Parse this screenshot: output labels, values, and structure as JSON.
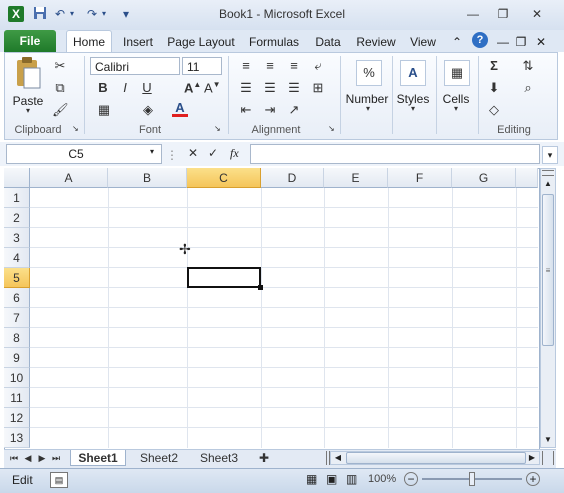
{
  "window": {
    "title": "Book1  -  Microsoft Excel",
    "qat_icons": [
      "excel-logo-icon",
      "save-icon",
      "undo-icon",
      "redo-icon",
      "customize-qat-icon"
    ],
    "controls": [
      "minimize",
      "restore",
      "close"
    ]
  },
  "tabs": {
    "file": "File",
    "items": [
      "Home",
      "Insert",
      "Page Layout",
      "Formulas",
      "Data",
      "Review",
      "View"
    ],
    "active": "Home"
  },
  "ribbon": {
    "clipboard": {
      "paste_label": "Paste",
      "group_label": "Clipboard"
    },
    "font": {
      "name": "Calibri",
      "size": "11",
      "group_label": "Font",
      "font_color": "#e02020"
    },
    "alignment": {
      "group_label": "Alignment"
    },
    "number": {
      "label": "Number"
    },
    "styles": {
      "label": "Styles"
    },
    "cells": {
      "label": "Cells"
    },
    "editing": {
      "group_label": "Editing"
    }
  },
  "formula_bar": {
    "name_box": "C5",
    "formula": "",
    "fx": "fx"
  },
  "grid": {
    "columns": [
      "A",
      "B",
      "C",
      "D",
      "E",
      "F",
      "G"
    ],
    "rows": [
      "1",
      "2",
      "3",
      "4",
      "5",
      "6",
      "7",
      "8",
      "9",
      "10",
      "11",
      "12",
      "13"
    ],
    "selected_column": "C",
    "selected_row": "5"
  },
  "sheets": {
    "tabs": [
      "Sheet1",
      "Sheet2",
      "Sheet3"
    ],
    "active": "Sheet1"
  },
  "status": {
    "mode": "Edit",
    "zoom": "100%"
  },
  "colors": {
    "accent": "#1f7a2a",
    "selection": "#f5c55a"
  }
}
